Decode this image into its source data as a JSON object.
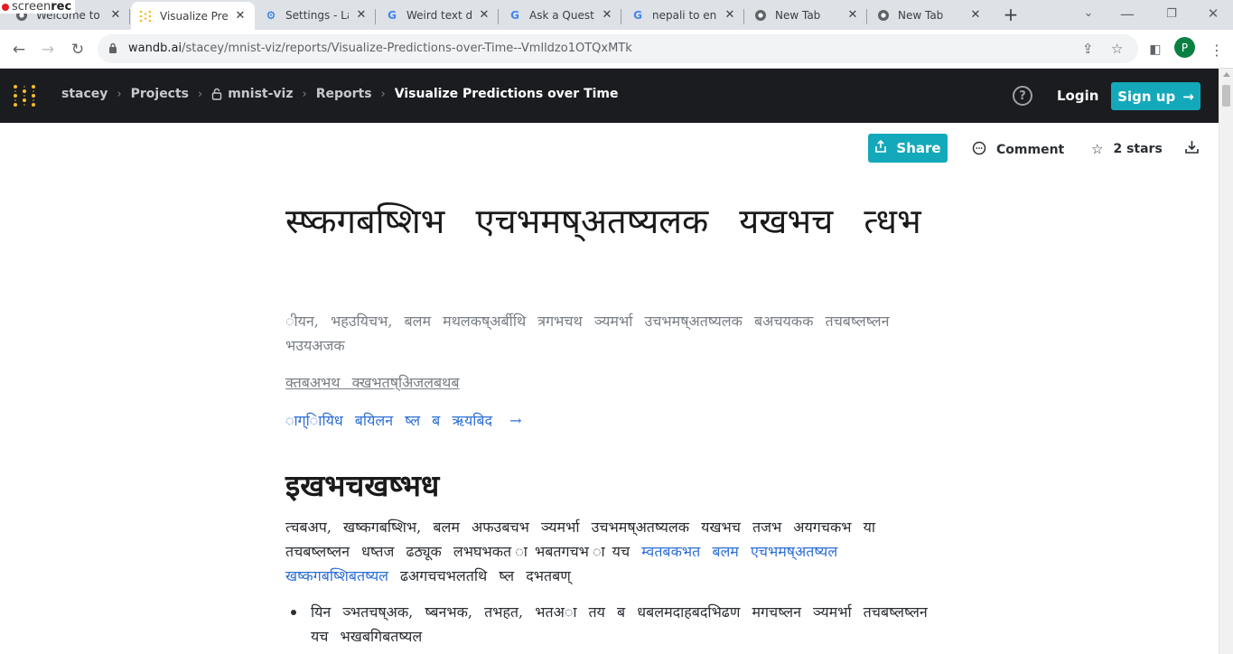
{
  "browser": {
    "tabs": [
      {
        "title": "Welcome to C",
        "favicon": "chrome-icon"
      },
      {
        "title": "Visualize Pred",
        "favicon": "wandb-icon"
      },
      {
        "title": "Settings - Lan",
        "favicon": "settings-gear-icon"
      },
      {
        "title": "Weird text dis",
        "favicon": "google-icon"
      },
      {
        "title": "Ask a Questio",
        "favicon": "google-icon"
      },
      {
        "title": "nepali to eng",
        "favicon": "google-icon"
      },
      {
        "title": "New Tab",
        "favicon": "chrome-icon"
      },
      {
        "title": "New Tab",
        "favicon": "chrome-icon"
      }
    ],
    "active_tab_index": 1,
    "url_host": "wandb.ai",
    "url_path": "/stacey/mnist-viz/reports/Visualize-Predictions-over-Time--Vmlldzo1OTQxMTk",
    "profile_initial": "P",
    "overlay_brand_light": "screen",
    "overlay_brand_bold": "rec"
  },
  "header": {
    "breadcrumbs": [
      "stacey",
      "Projects",
      "mnist-viz",
      "Reports"
    ],
    "current": "Visualize Predictions over Time",
    "login": "Login",
    "signup": "Sign up",
    "accent_color": "#13a9ba",
    "background_color": "#1a1c1f"
  },
  "actions": {
    "share": "Share",
    "comment": "Comment",
    "stars": "2 stars"
  },
  "report": {
    "title": "स्ष्कगबष्शिभ एचभमष्अतष्यलक यखभच त्धभ",
    "subtitle": "ीयन, भहउयिचभ, बलम मथलकष्अर्बीथि त्रगभचथ ञ्यमर्भा उचभमष्अतष्यलक बअचयकक तचबष्लष्लन भउयअजक",
    "author_link": "क्तबअभथ क्खभतष्अिजलबथब",
    "cta_link": "ाग्ाियिध बयिलन ष्ल ब ऋयबिद",
    "cta_arrow": "→",
    "section_heading": "इखभचखष्भध",
    "paragraph_text": "त्चबअप, खष्कगबष्शिभ, बलम अफउबचभ ञ्यमर्भा उचभमष्अतष्यलक यखभच तजभ अयगचकभ या तचबष्लष्लन धष्तज ढठ्यूक लभघभकत ाभबतगचभ ायच",
    "paragraph_link": "म्वतबकभत बलम एचभमष्अतष्यल खष्कगबष्शिबतष्यल",
    "paragraph_tail": "ढअगचचभलतथि ष्ल दभतबण्",
    "bullet_1": "यिन ञ्भतचष्अक, ष्बनभक, तभहत, भतअा तय ब धबलमदाहबदभिढण मगचष्लन ञ्यमर्भा तचबष्लष्लन यच भखबगिबतष्यल"
  }
}
